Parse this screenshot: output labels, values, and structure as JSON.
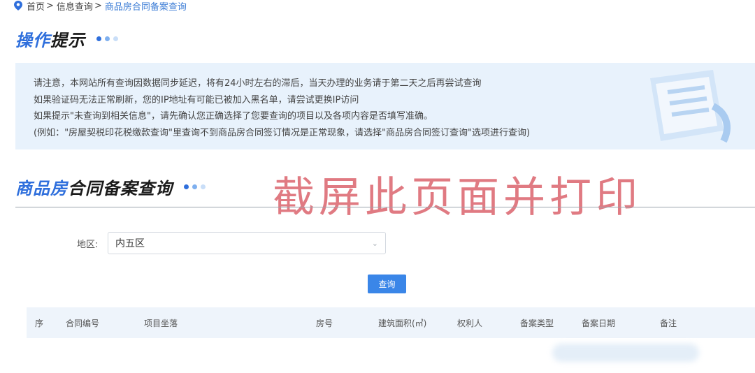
{
  "breadcrumb": {
    "home": "首页",
    "info": "信息查询",
    "current": "商品房合同备案查询",
    "separator": ">"
  },
  "tips": {
    "title_highlight": "操作",
    "title_rest": "提示",
    "lines": [
      "请注意，本网站所有查询因数据同步延迟，将有24小时左右的滞后，当天办理的业务请于第二天之后再尝试查询",
      "如果验证码无法正常刷新，您的IP地址有可能已被加入黑名单，请尝试更换IP访问",
      "如果提示\"未查询到相关信息\"，请先确认您正确选择了您要查询的项目以及各项内容是否填写准确。",
      "(例如：\"房屋契税印花税缴款查询\"里查询不到商品房合同签订情况是正常现象，请选择\"商品房合同签订查询\"选项进行查询)"
    ]
  },
  "query": {
    "title_highlight": "商品房",
    "title_rest": "合同备案查询",
    "watermark": "截屏此页面并打印",
    "region_label": "地区:",
    "region_value": "内五区",
    "search_button": "查询"
  },
  "table": {
    "columns": [
      "序",
      "合同编号",
      "项目坐落",
      "房号",
      "建筑面积(㎡)",
      "权利人",
      "备案类型",
      "备案日期",
      "备注"
    ]
  },
  "colors": {
    "accent": "#2f6fdc",
    "button": "#3a86e8",
    "notice_bg": "#e8f2fc",
    "watermark": "#e07a82"
  },
  "icons": {
    "location": "location-pin-icon",
    "dropdown": "chevron-down-icon"
  }
}
